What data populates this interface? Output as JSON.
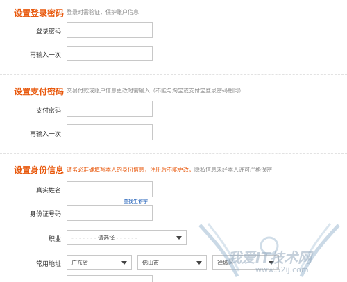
{
  "login_section": {
    "title": "设置登录密码",
    "subtitle": "登录时需验证，保护账户信息",
    "fields": {
      "password_label": "登录密码",
      "confirm_label": "再输入一次"
    }
  },
  "payment_section": {
    "title": "设置支付密码",
    "subtitle": "交易付款或账户信息更改时需输入（不能与淘宝或支付宝登录密码相同）",
    "fields": {
      "password_label": "支付密码",
      "confirm_label": "再输入一次"
    }
  },
  "identity_section": {
    "title": "设置身份信息",
    "subtitle_warning": "请务必准确填写本人的身份信息，注册后不能更改，",
    "subtitle_note": "隐私信息未经本人许可严格保密",
    "fields": {
      "name_label": "真实姓名",
      "rare_char_link": "查找生僻字",
      "id_label": "身份证号码",
      "occupation_label": "职业",
      "occupation_value": "- - - - - - - 请选择 - - - - - -",
      "address_label": "常用地址",
      "province_value": "广东省",
      "city_value": "佛山市",
      "district_value": "禅城区"
    }
  },
  "watermark": {
    "text": "我爱IT技术网",
    "url": "www.52ij.com"
  }
}
